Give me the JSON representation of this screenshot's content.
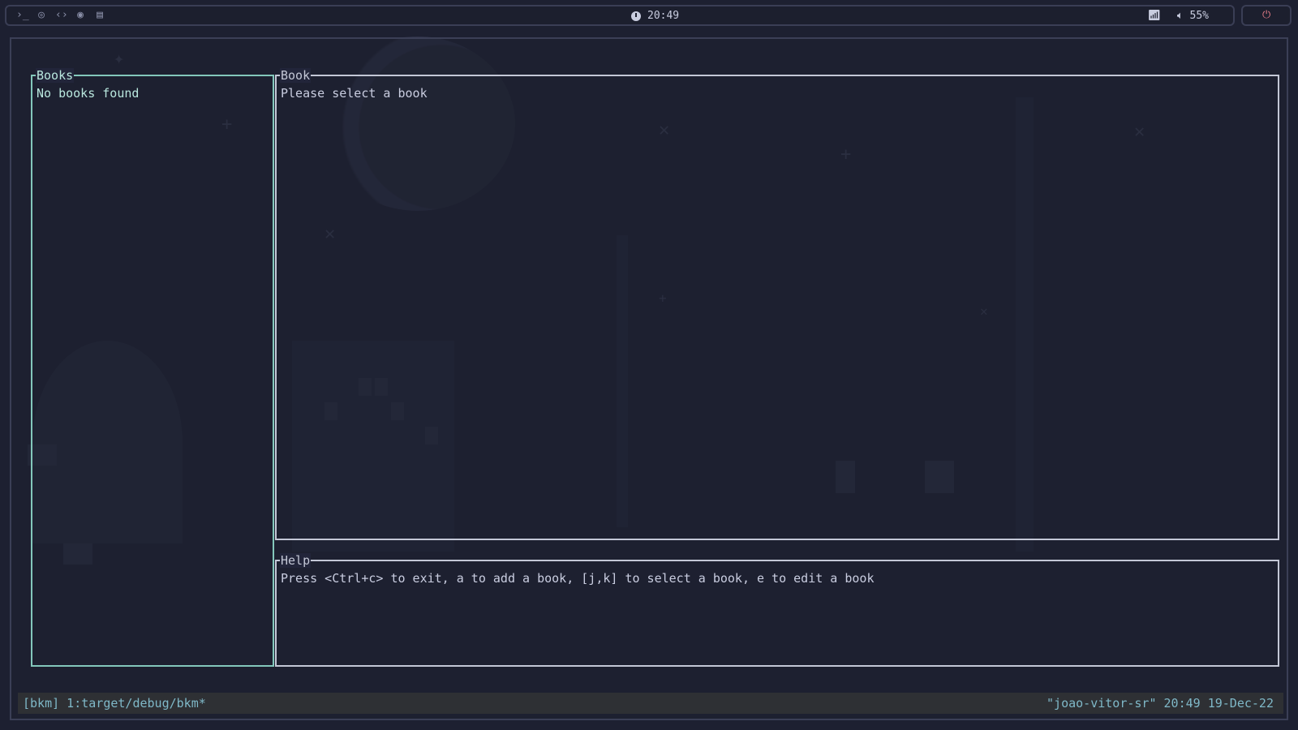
{
  "topbar": {
    "left_icons": [
      "terminal-icon",
      "browser-icon",
      "code-icon",
      "music-icon",
      "document-icon"
    ],
    "time": "20:49",
    "volume": "55%",
    "right_icons": [
      "wifi-icon",
      "volume-icon",
      "power-icon"
    ]
  },
  "panels": {
    "books": {
      "title": "Books",
      "body": "No books found"
    },
    "book": {
      "title": "Book",
      "body": "Please select a book"
    },
    "help": {
      "title": "Help",
      "body": "Press <Ctrl+c> to exit, a to add a book, [j,k] to select a book, e to edit a book"
    }
  },
  "statusbar": {
    "left": "[bkm] 1:target/debug/bkm*",
    "right": "\"joao-vitor-sr\" 20:49 19-Dec-22"
  },
  "colors": {
    "background": "#1d2031",
    "books_border": "#83c7bb",
    "panel_border": "#c3c7d6",
    "status_text": "#7fb8c8",
    "status_bg": "#2e3034",
    "power_accent": "#e07a85"
  }
}
